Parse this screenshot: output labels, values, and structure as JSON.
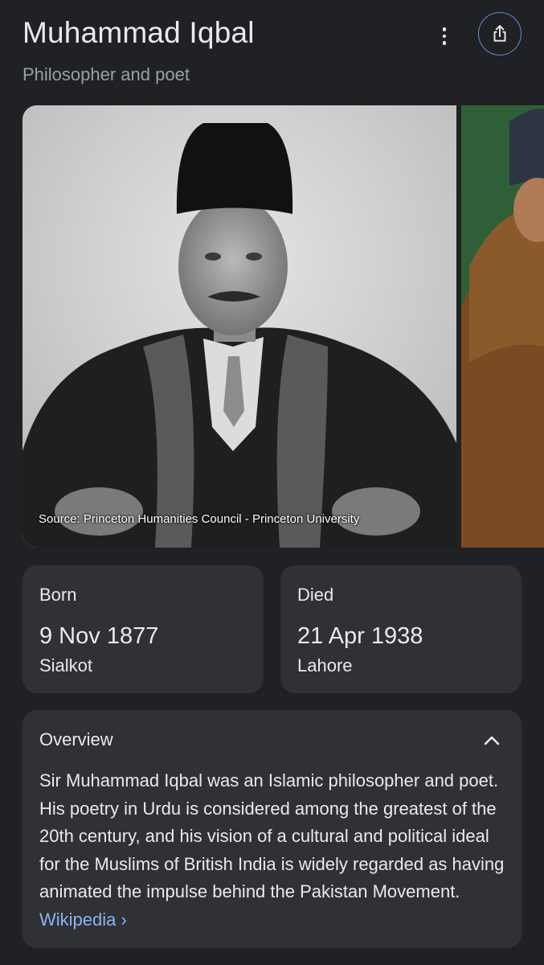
{
  "header": {
    "title": "Muhammad Iqbal",
    "subtitle": "Philosopher and poet",
    "more_icon": "vertical-dots-icon",
    "share_icon": "share-icon"
  },
  "gallery": {
    "caption": "Source: Princeton Humanities Council - Princeton University"
  },
  "facts": {
    "born": {
      "label": "Born",
      "date": "9 Nov 1877",
      "place": "Sialkot"
    },
    "died": {
      "label": "Died",
      "date": "21 Apr 1938",
      "place": "Lahore"
    }
  },
  "overview": {
    "title": "Overview",
    "text": "Sir Muhammad Iqbal was an Islamic philosopher and poet. His poetry in Urdu is considered among the greatest of the 20th century, and his vision of a cultural and political ideal for the Muslims of British India is widely regarded as having animated the impulse behind the Pakistan Movement. ",
    "link_label": "Wikipedia",
    "link_chevron": "›",
    "collapse_icon": "chevron-up-icon"
  },
  "colors": {
    "background": "#202124",
    "card": "#303134",
    "text": "#e8eaed",
    "muted": "#9aa0a6",
    "link": "#8ab4f8"
  }
}
